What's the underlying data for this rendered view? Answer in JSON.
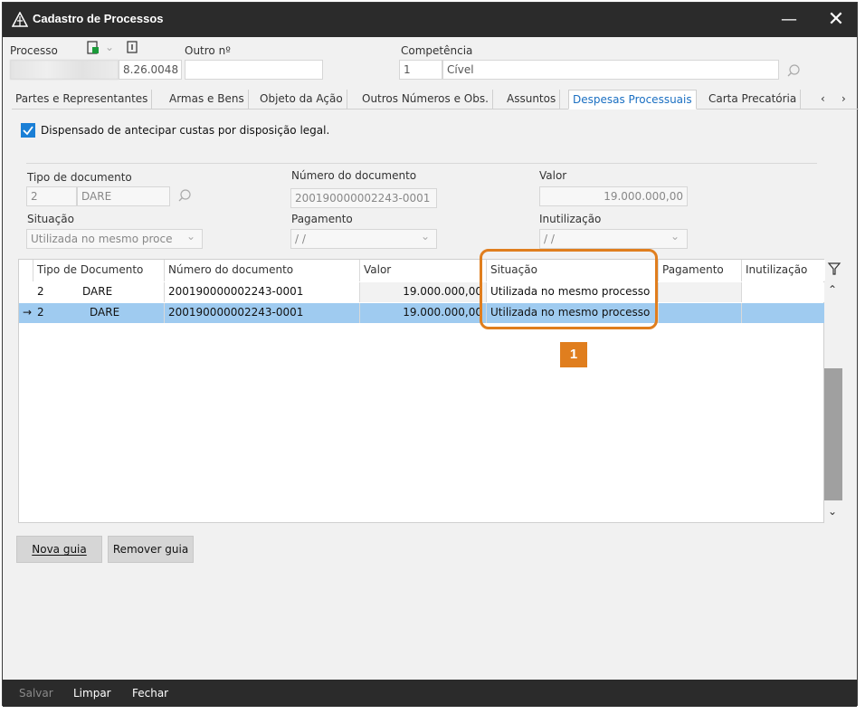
{
  "window": {
    "title": "Cadastro de Processos"
  },
  "header": {
    "processo_label": "Processo",
    "processo_suffix": "8.26.0048",
    "outro_label": "Outro nº",
    "outro_value": "",
    "competencia_label": "Competência",
    "competencia_code": "1",
    "competencia_value": "Cível"
  },
  "tabs": [
    "Partes e Representantes",
    "Armas e Bens",
    "Objeto da Ação",
    "Outros Números e Obs.",
    "Assuntos",
    "Despesas Processuais",
    "Carta Precatória"
  ],
  "tab_arrows": {
    "prev": "‹",
    "next": "›"
  },
  "form": {
    "dispensado_label": "Dispensado de antecipar custas por disposição legal.",
    "dispensado_checked": true,
    "tipo_label": "Tipo de documento",
    "tipo_code": "2",
    "tipo_value": "DARE",
    "numero_label": "Número do documento",
    "numero_value": "200190000002243-0001",
    "valor_label": "Valor",
    "valor_value": "19.000.000,00",
    "situacao_label": "Situação",
    "situacao_value": "Utilizada no mesmo proce",
    "pagamento_label": "Pagamento",
    "pagamento_value": "/ /",
    "inutilizacao_label": "Inutilização",
    "inutilizacao_value": "/ /"
  },
  "grid": {
    "headers": [
      "Tipo de Documento",
      "Número do documento",
      "Valor",
      "Situação",
      "Pagamento",
      "Inutilização"
    ],
    "rows": [
      {
        "indicator": "",
        "tipo_code": "2",
        "tipo": "DARE",
        "numero": "200190000002243-0001",
        "valor": "19.000.000,00",
        "situacao": "Utilizada no mesmo processo",
        "pagamento": "",
        "inutilizacao": ""
      },
      {
        "indicator": "→",
        "tipo_code": "2",
        "tipo": "DARE",
        "numero": "200190000002243-0001",
        "valor": "19.000.000,00",
        "situacao": "Utilizada no mesmo processo",
        "pagamento": "",
        "inutilizacao": ""
      }
    ]
  },
  "buttons": {
    "nova_guia": "Nova guia",
    "remover_guia": "Remover guia"
  },
  "footer": {
    "salvar": "Salvar",
    "limpar": "Limpar",
    "fechar": "Fechar"
  },
  "annotation": {
    "callout_number": "1"
  },
  "colors": {
    "accent": "#1a7fd6",
    "highlight": "#e07e1e",
    "selected_row": "#9fcbf0",
    "titlebar": "#2b2b2b"
  }
}
